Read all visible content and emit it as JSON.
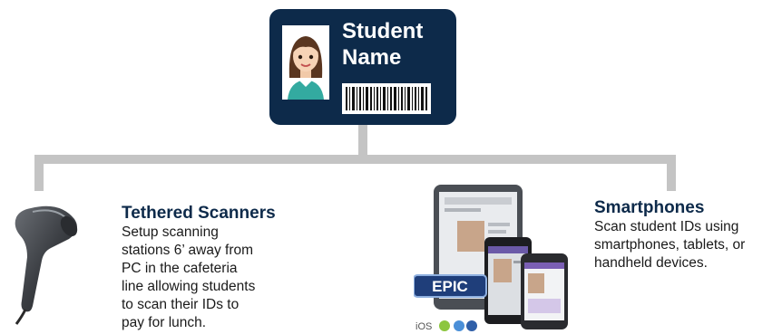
{
  "id_card": {
    "name": "Student Name",
    "colors": {
      "background": "#0d2a4a",
      "text": "#ffffff"
    }
  },
  "icons": {
    "avatar": "student-avatar-icon",
    "barcode": "barcode-icon",
    "scanner": "handheld-barcode-scanner-icon",
    "devices": "tablet-smartphones-icon",
    "platforms": [
      "ios-logo",
      "android-logo",
      "chrome-logo",
      "bluetooth-logo"
    ]
  },
  "device_image": {
    "brand_badge": "EPIC",
    "platform_label": "iOS"
  },
  "tethered": {
    "title": "Tethered Scanners",
    "text": "Setup scanning stations 6’ away from PC in the cafeteria line allowing students to scan their IDs to pay for lunch."
  },
  "smartphones": {
    "title": "Smartphones",
    "text": "Scan student IDs using smartphones, tablets, or handheld devices."
  },
  "colors": {
    "accent": "#0d2a4a",
    "connector": "#c4c4c4"
  }
}
